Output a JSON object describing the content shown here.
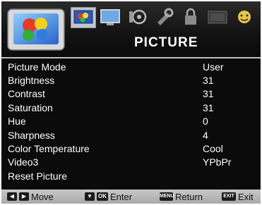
{
  "menu": {
    "title": "PICTURE",
    "tabs": [
      {
        "name": "picture-tab-icon",
        "active": true
      },
      {
        "name": "screen-tab-icon"
      },
      {
        "name": "sound-tab-icon"
      },
      {
        "name": "setup-tab-icon"
      },
      {
        "name": "lock-tab-icon"
      },
      {
        "name": "channel-tab-icon"
      },
      {
        "name": "fun-tab-icon"
      }
    ],
    "items": [
      {
        "label": "Picture Mode",
        "value": "User"
      },
      {
        "label": "Brightness",
        "value": "31"
      },
      {
        "label": "Contrast",
        "value": "31"
      },
      {
        "label": "Saturation",
        "value": "31"
      },
      {
        "label": "Hue",
        "value": "0"
      },
      {
        "label": "Sharpness",
        "value": "4"
      },
      {
        "label": "Color Temperature",
        "value": "Cool"
      },
      {
        "label": "Video3",
        "value": "YPbPr"
      },
      {
        "label": "Reset Picture",
        "value": ""
      }
    ]
  },
  "footer": {
    "move": "Move",
    "enter_key": "OK",
    "enter": "Enter",
    "return_key": "MENU",
    "return": "Return",
    "exit_key": "EXIT",
    "exit": "Exit"
  }
}
